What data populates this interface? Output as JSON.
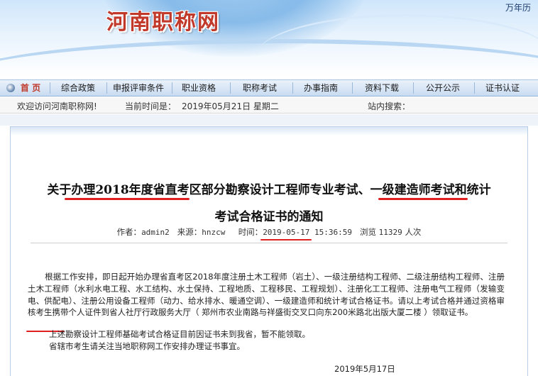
{
  "banner": {
    "site_title": "河南职称网",
    "calendar_link": "万年历"
  },
  "nav": {
    "items": [
      {
        "label": "首 页"
      },
      {
        "label": "综合政策"
      },
      {
        "label": "申报评审条件"
      },
      {
        "label": "职业资格"
      },
      {
        "label": "职称考试"
      },
      {
        "label": "办事指南"
      },
      {
        "label": "资料下载"
      },
      {
        "label": "公开公示"
      },
      {
        "label": "证书认证"
      }
    ]
  },
  "infobar": {
    "welcome": "欢迎访问河南职称网!",
    "time_label": "当前时间是：",
    "time_value": "2019年05月21日  星期二",
    "search_label": "站内搜索："
  },
  "article": {
    "title_line1": "关于办理2018年度省直考区部分勘察设计工程师专业考试、一级建造师考试和统计",
    "title_line2": "考试合格证书的通知",
    "author_label": "作者：",
    "author": "admin2",
    "source_label": "来源：",
    "source": "hnzcw",
    "time_label": "时间：",
    "time": "2019-05-17 15:36:59",
    "views_label": "浏览",
    "views": "11329",
    "views_unit": "人次",
    "paragraph1": "根据工作安排，即日起开始办理省直考区2018年度注册土木工程师（岩土）、一级注册结构工程师、二级注册结构工程师、注册土木工程师（水利水电工程、水工结构、水土保持、工程地质、工程移民、工程规划）、注册化工工程师、注册电气工程师（发输变电、供配电）、注册公用设备工程师（动力、给水排水、暖通空调）、一级建造师和统计考试合格证书。请以上考试合格并通过资格审核考生携带个人证件到省人社厅行政服务大厅（ 郑州市农业南路与祥盛街交叉口向东200米路北出版大厦二楼 ）领取证书。",
    "paragraph2": "上述勘察设计工程师基础考试合格证目前因证书未到我省，暂不能领取。",
    "paragraph3": "省辖市考生请关注当地职称网工作安排办理证书事宜。",
    "date": "2019年5月17日"
  },
  "colors": {
    "title_red": "#c0392b",
    "underline_red": "#e02020",
    "nav_bg": "#c9dcf1"
  }
}
